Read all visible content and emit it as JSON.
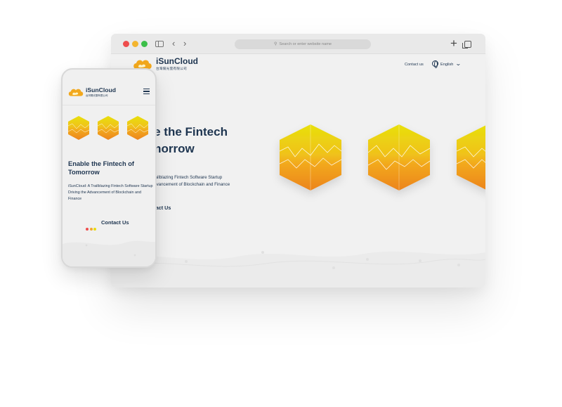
{
  "browser": {
    "address_placeholder": "Search or enter website name",
    "icons": [
      "sidebar-toggle-icon",
      "back-icon",
      "forward-icon",
      "search-icon",
      "new-tab-icon",
      "tabs-overview-icon"
    ]
  },
  "site": {
    "brand": "iSunCloud",
    "brand_sub": "台灣陽光雲有限公司",
    "nav_contact": "Contact us",
    "language": "English",
    "hero_title": "Enable the Fintech of Tomorrow",
    "hero_subtitle": "iSunCloud: A Trailblazing Fintech Software Startup Driving the Advancement of Blockchain and Finance",
    "cta": "Contact Us"
  },
  "desktop_visible": {
    "hero_title_line1": "ble the Fintech",
    "hero_title_line2": "omorrow",
    "hero_sub_line1": "Trailblazing Fintech Software Startup",
    "hero_sub_line2": "Advancement of Blockchain and Finance",
    "cta": "ntact Us"
  },
  "phone": {
    "brand": "iSunCloud",
    "brand_sub": "台灣陽光雲有限公司",
    "title": "Enable the Fintech of Tomorrow",
    "subtitle": "iSunCloud: A Trailblazing Fintech Software Startup Driving the Advancement of Blockchain and Finance",
    "cta": "Contact Us"
  },
  "colors": {
    "navy": "#1e3550",
    "hex_top": "#e8dc0c",
    "hex_mid": "#f2b51a",
    "hex_bottom": "#ee8a1e",
    "dot_red": "#ee4d4d",
    "dot_yellow": "#f3b52f",
    "dot_green": "#3cbf49"
  }
}
